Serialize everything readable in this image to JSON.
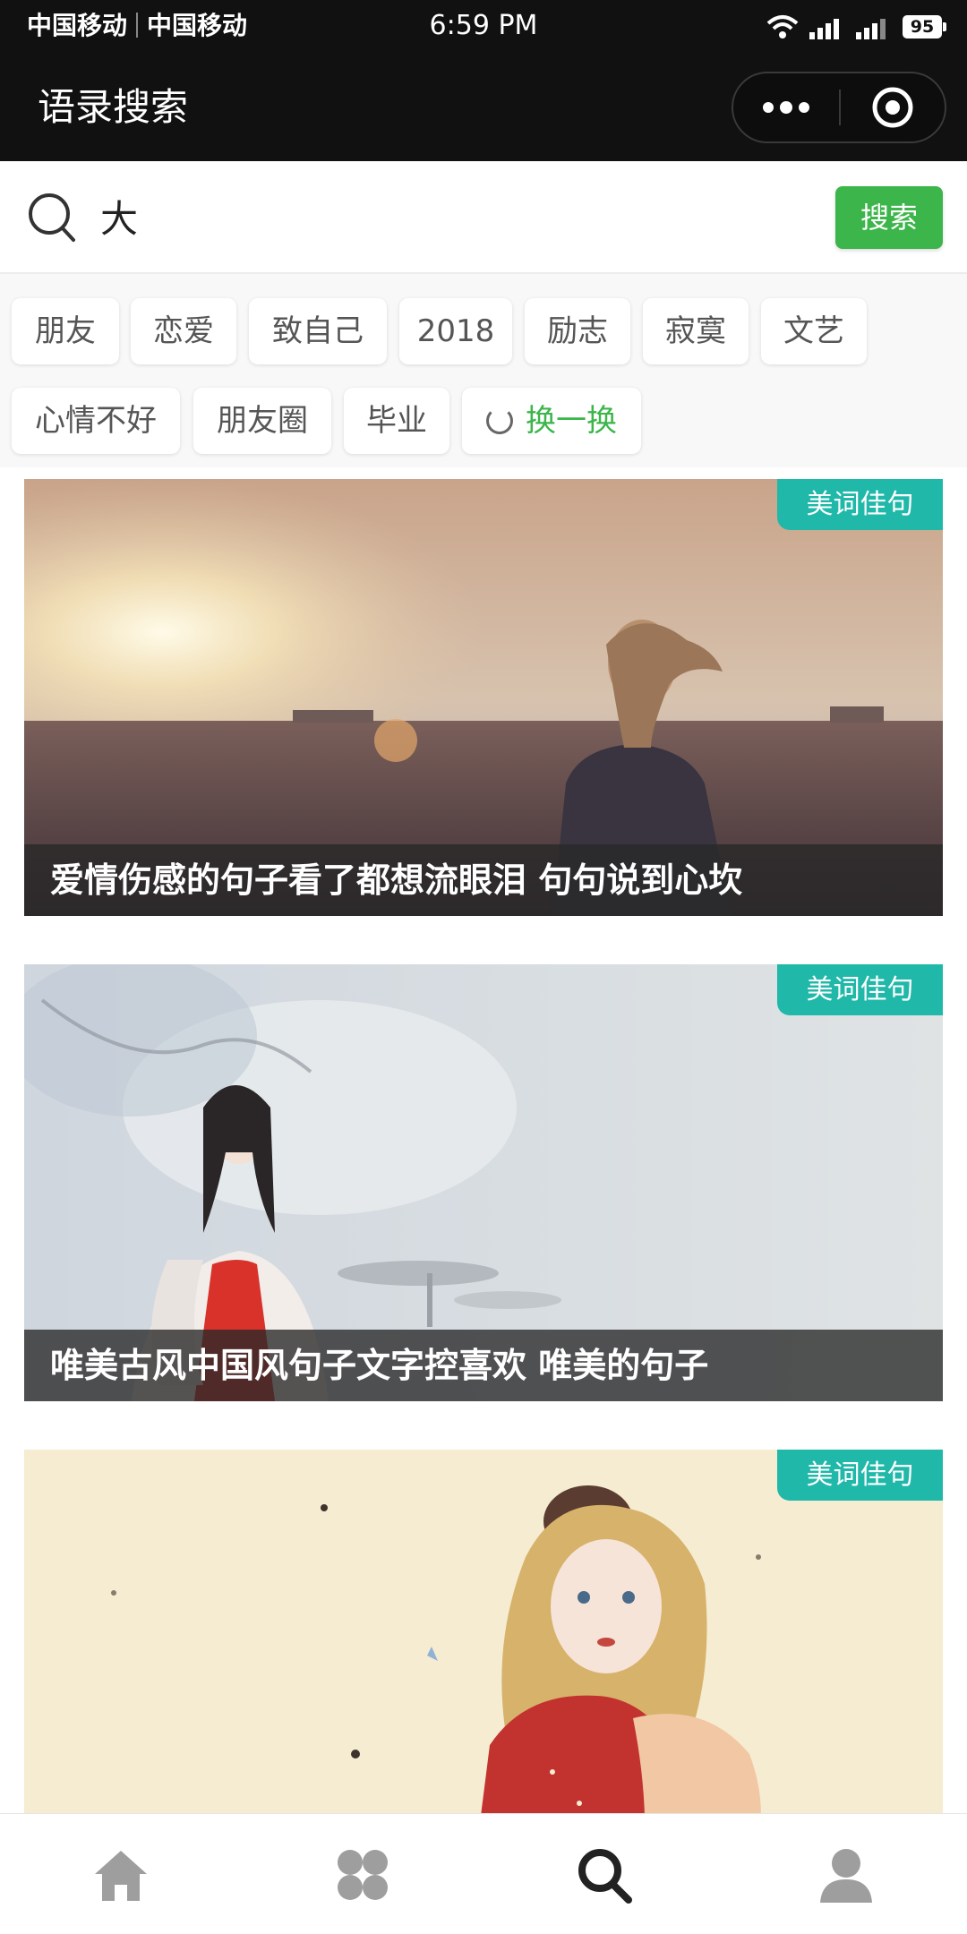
{
  "status_bar": {
    "carrier_1": "中国移动",
    "carrier_2": "中国移动",
    "time": "6:59 PM",
    "battery": "95"
  },
  "nav": {
    "title": "语录搜索"
  },
  "search": {
    "value": "大",
    "button_label": "搜索"
  },
  "tags": [
    "朋友",
    "恋爱",
    "致自己",
    "2018",
    "励志",
    "寂寞",
    "文艺",
    "心情不好",
    "朋友圈",
    "毕业"
  ],
  "refresh_label": "换一换",
  "cards": [
    {
      "badge": "美词佳句",
      "title": "爱情伤感的句子看了都想流眼泪 句句说到心坎"
    },
    {
      "badge": "美词佳句",
      "title": "唯美古风中国风句子文字控喜欢 唯美的句子"
    },
    {
      "badge": "美词佳句",
      "title": ""
    }
  ],
  "tabbar": {
    "items": [
      "home-icon",
      "apps-icon",
      "search-icon",
      "user-icon"
    ],
    "active_index": 2
  },
  "colors": {
    "accent": "#3cb54a",
    "badge": "#1fb8a9",
    "nav_bg": "#111111"
  }
}
